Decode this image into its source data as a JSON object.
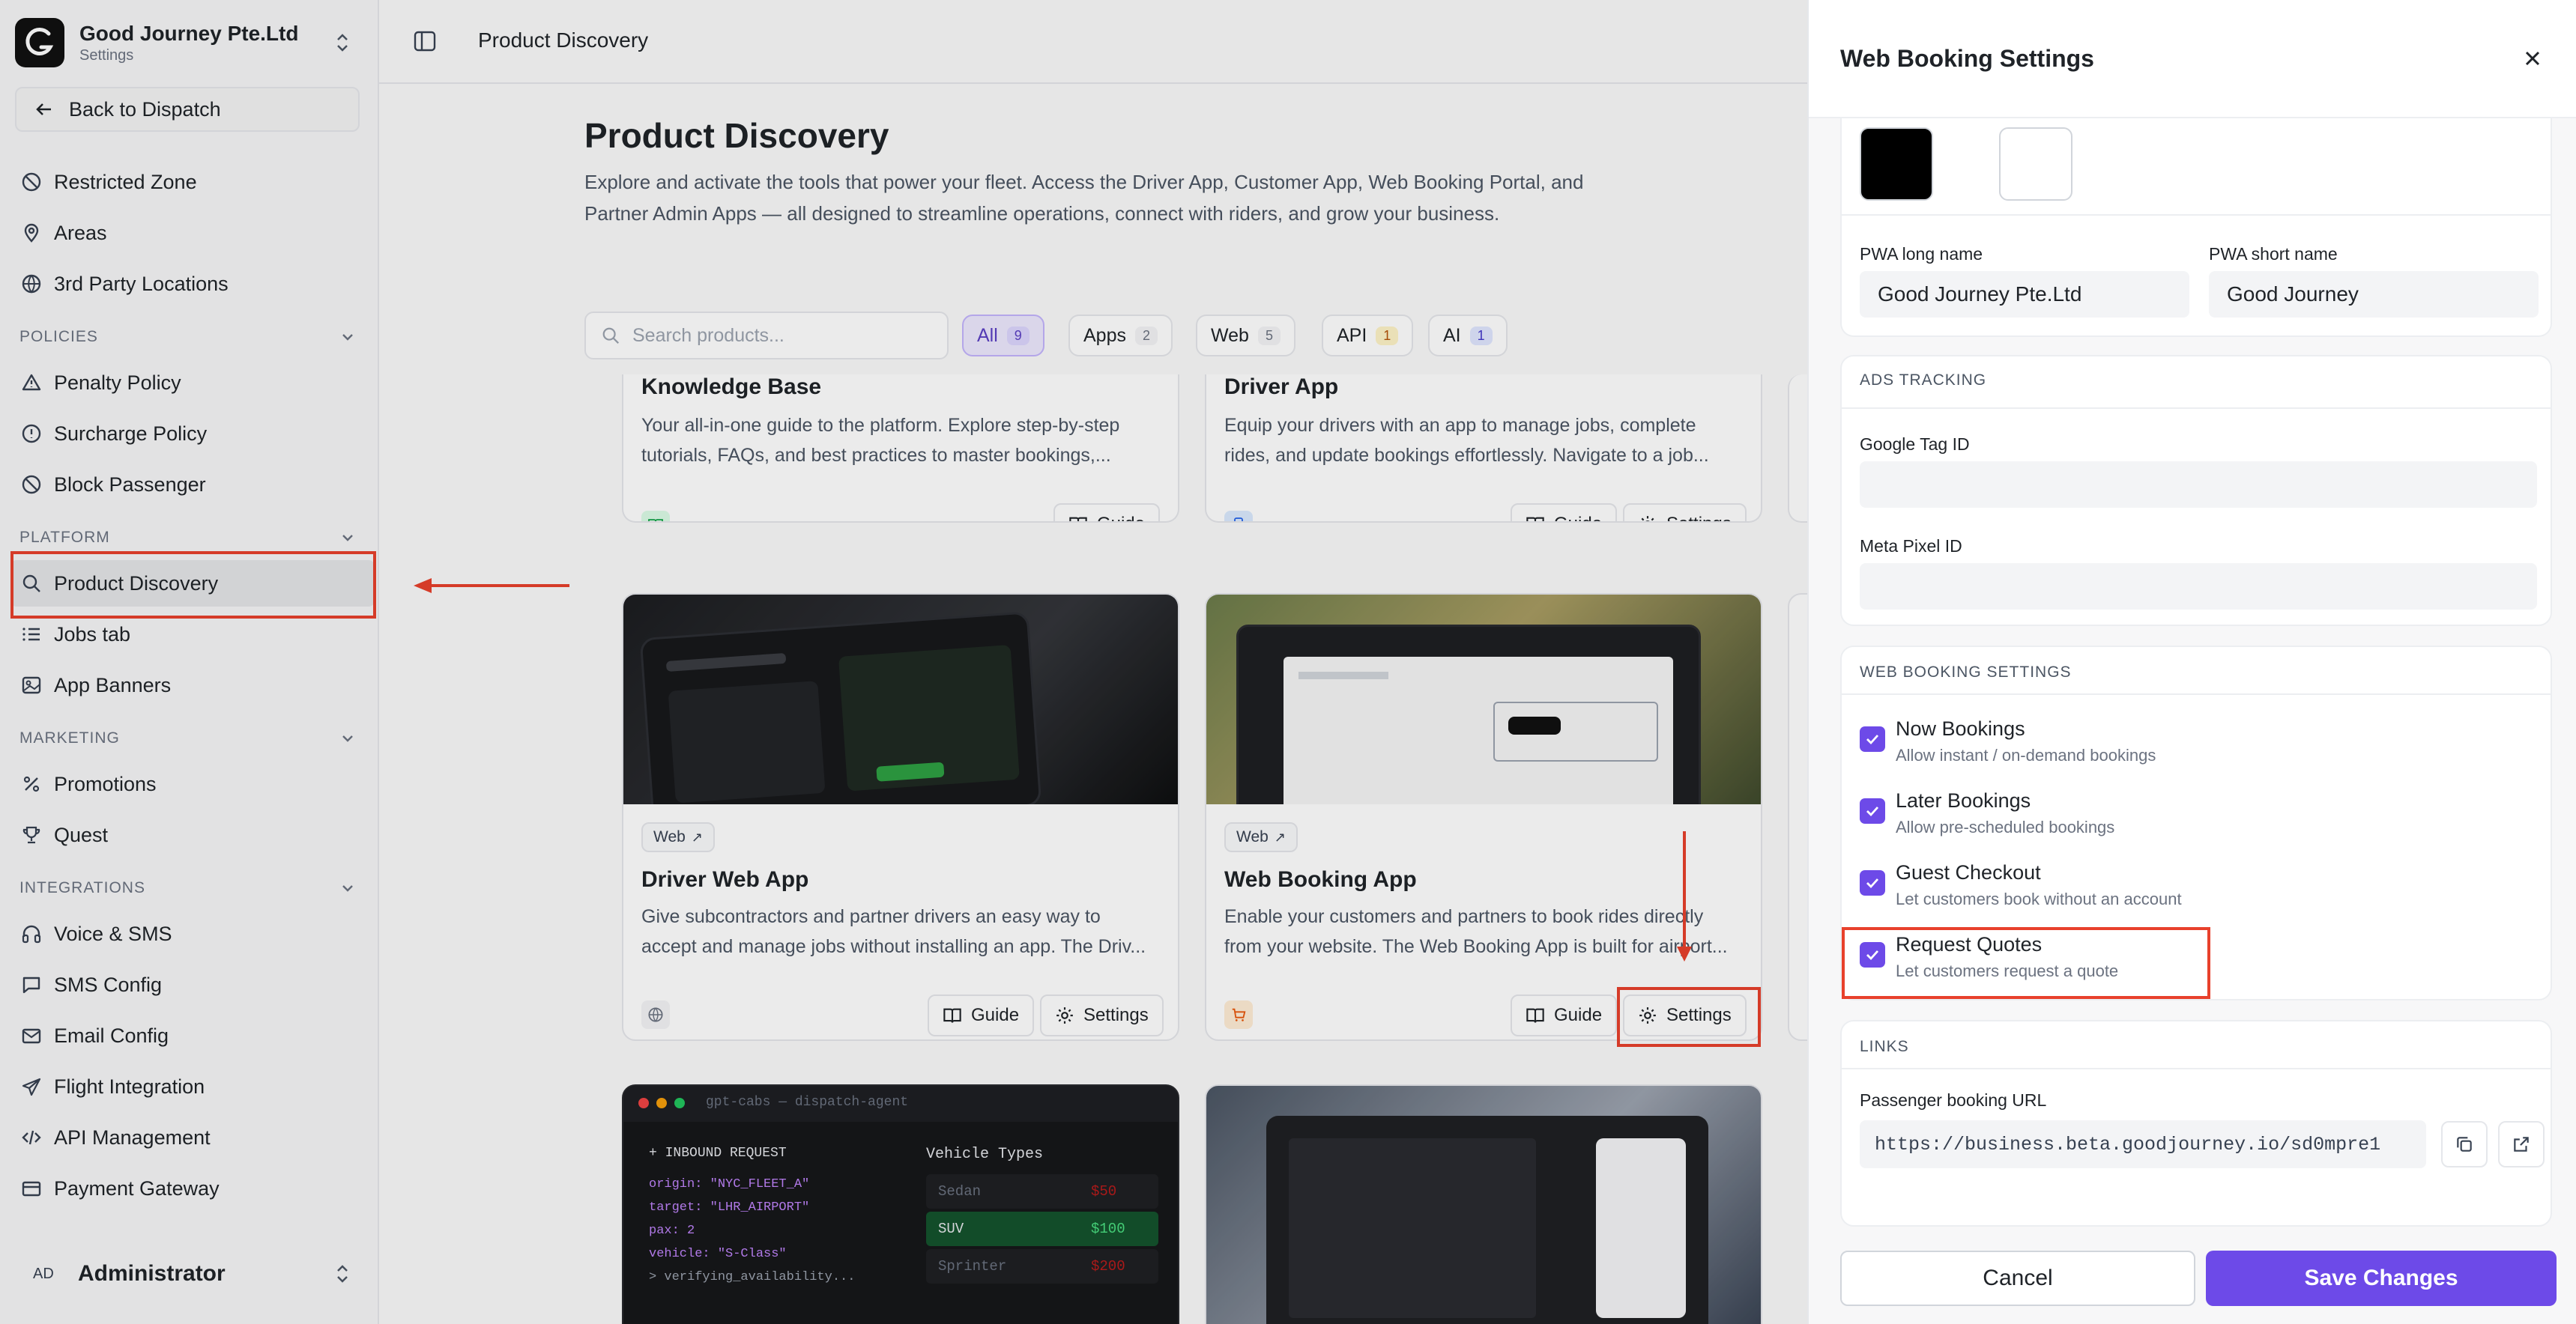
{
  "sidebar": {
    "org_name": "Good Journey Pte.Ltd",
    "org_sub": "Settings",
    "back": "Back to Dispatch",
    "items_top": [
      "Restricted Zone",
      "Areas",
      "3rd Party Locations"
    ],
    "policies_label": "POLICIES",
    "policies": [
      "Penalty Policy",
      "Surcharge Policy",
      "Block Passenger"
    ],
    "platform_label": "PLATFORM",
    "platform": [
      "Product Discovery",
      "Jobs tab",
      "App Banners"
    ],
    "marketing_label": "MARKETING",
    "marketing": [
      "Promotions",
      "Quest"
    ],
    "integrations_label": "INTEGRATIONS",
    "integrations": [
      "Voice & SMS",
      "SMS Config",
      "Email Config",
      "Flight Integration",
      "API Management",
      "Payment Gateway"
    ],
    "user_initials": "AD",
    "user_name": "Administrator"
  },
  "main": {
    "breadcrumb": "Product Discovery",
    "title": "Product Discovery",
    "description": "Explore and activate the tools that power your fleet. Access the Driver App, Customer App, Web Booking Portal, and Partner Admin Apps — all designed to streamline operations, connect with riders, and grow your business.",
    "search_placeholder": "Search products...",
    "chips": [
      {
        "label": "All",
        "count": "9"
      },
      {
        "label": "Apps",
        "count": "2"
      },
      {
        "label": "Web",
        "count": "5"
      },
      {
        "label": "API",
        "count": "1"
      },
      {
        "label": "AI",
        "count": "1"
      }
    ],
    "cards": [
      {
        "title": "Knowledge Base",
        "desc": "Your all-in-one guide to the platform. Explore step-by-step tutorials, FAQs, and best practices to master bookings,...",
        "guide": "Guide"
      },
      {
        "title": "Driver App",
        "desc": "Equip your drivers with an app to manage jobs, complete rides, and update bookings effortlessly. Navigate to a job...",
        "guide": "Guide",
        "settings": "Settings"
      },
      {
        "tag": "Web",
        "title": "Driver Web App",
        "desc": "Give subcontractors and partner drivers an easy way to accept and manage jobs without installing an app. The Driv...",
        "guide": "Guide",
        "settings": "Settings"
      },
      {
        "tag": "Web",
        "title": "Web Booking App",
        "desc": "Enable your customers and partners to book rides directly from your website. The Web Booking App is built for airport...",
        "guide": "Guide",
        "settings": "Settings"
      }
    ],
    "code_card": {
      "header": "gpt-cabs — dispatch-agent",
      "inbound": "INBOUND REQUEST",
      "lines": [
        "origin: \"NYC_FLEET_A\"",
        "target: \"LHR_AIRPORT\"",
        "pax: 2",
        "vehicle: \"S-Class\"",
        "> verifying_availability..."
      ],
      "vt_title": "Vehicle Types",
      "vehicles": [
        {
          "name": "Sedan",
          "price": "$50"
        },
        {
          "name": "SUV",
          "price": "$100"
        },
        {
          "name": "Sprinter",
          "price": "$200"
        }
      ]
    }
  },
  "drawer": {
    "title": "Web Booking Settings",
    "pwa_long_label": "PWA long name",
    "pwa_long_value": "Good Journey Pte.Ltd",
    "pwa_short_label": "PWA short name",
    "pwa_short_value": "Good Journey",
    "ads_label": "ADS TRACKING",
    "gtag_label": "Google Tag ID",
    "gtag_value": "",
    "meta_label": "Meta Pixel ID",
    "meta_value": "",
    "wbs_label": "WEB BOOKING SETTINGS",
    "options": [
      {
        "title": "Now Bookings",
        "sub": "Allow instant / on-demand bookings"
      },
      {
        "title": "Later Bookings",
        "sub": "Allow pre-scheduled bookings"
      },
      {
        "title": "Guest Checkout",
        "sub": "Let customers book without an account"
      },
      {
        "title": "Request Quotes",
        "sub": "Let customers request a quote"
      }
    ],
    "links_label": "LINKS",
    "url_label": "Passenger booking URL",
    "url_value": "https://business.beta.goodjourney.io/sd0mpre1",
    "cancel": "Cancel",
    "save": "Save Changes"
  },
  "colors": {
    "accent": "#6d4ae8",
    "highlight": "#e8412c",
    "swatch_primary": "#000000",
    "swatch_secondary": "#ffffff"
  }
}
